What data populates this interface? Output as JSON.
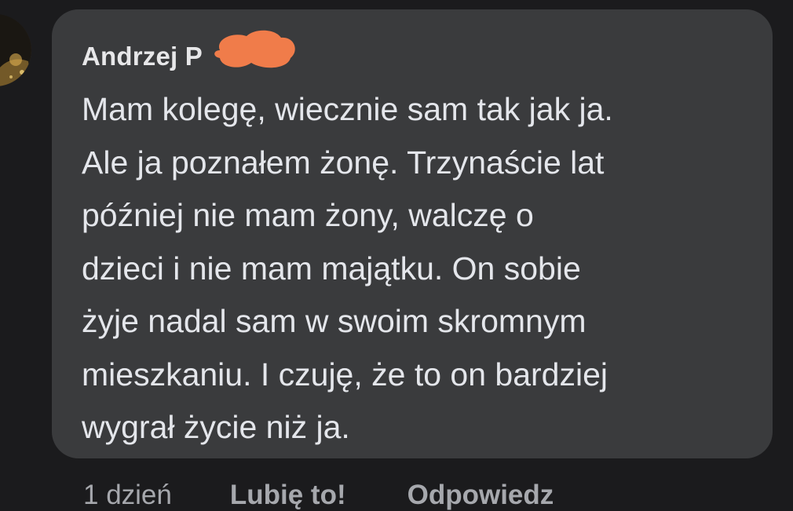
{
  "comment": {
    "author": "Andrzej P",
    "text_lines": [
      "Mam kolegę, wiecznie sam tak jak ja.",
      "Ale ja poznałem żonę. Trzynaście lat",
      "później nie mam żony, walczę o",
      "dzieci i nie mam majątku. On sobie",
      "żyje nadal sam w swoim skromnym",
      "mieszkaniu. I czuję, że to on bardziej",
      "wygrał życie niż ja."
    ]
  },
  "actions": {
    "timestamp": "1 dzień",
    "like_label": "Lubię to!",
    "reply_label": "Odpowiedz"
  },
  "colors": {
    "background": "#1b1b1d",
    "bubble": "#3a3b3d",
    "text": "#e4e6eb",
    "secondary_text": "#a6a8ad",
    "redaction": "#f07c4a"
  }
}
